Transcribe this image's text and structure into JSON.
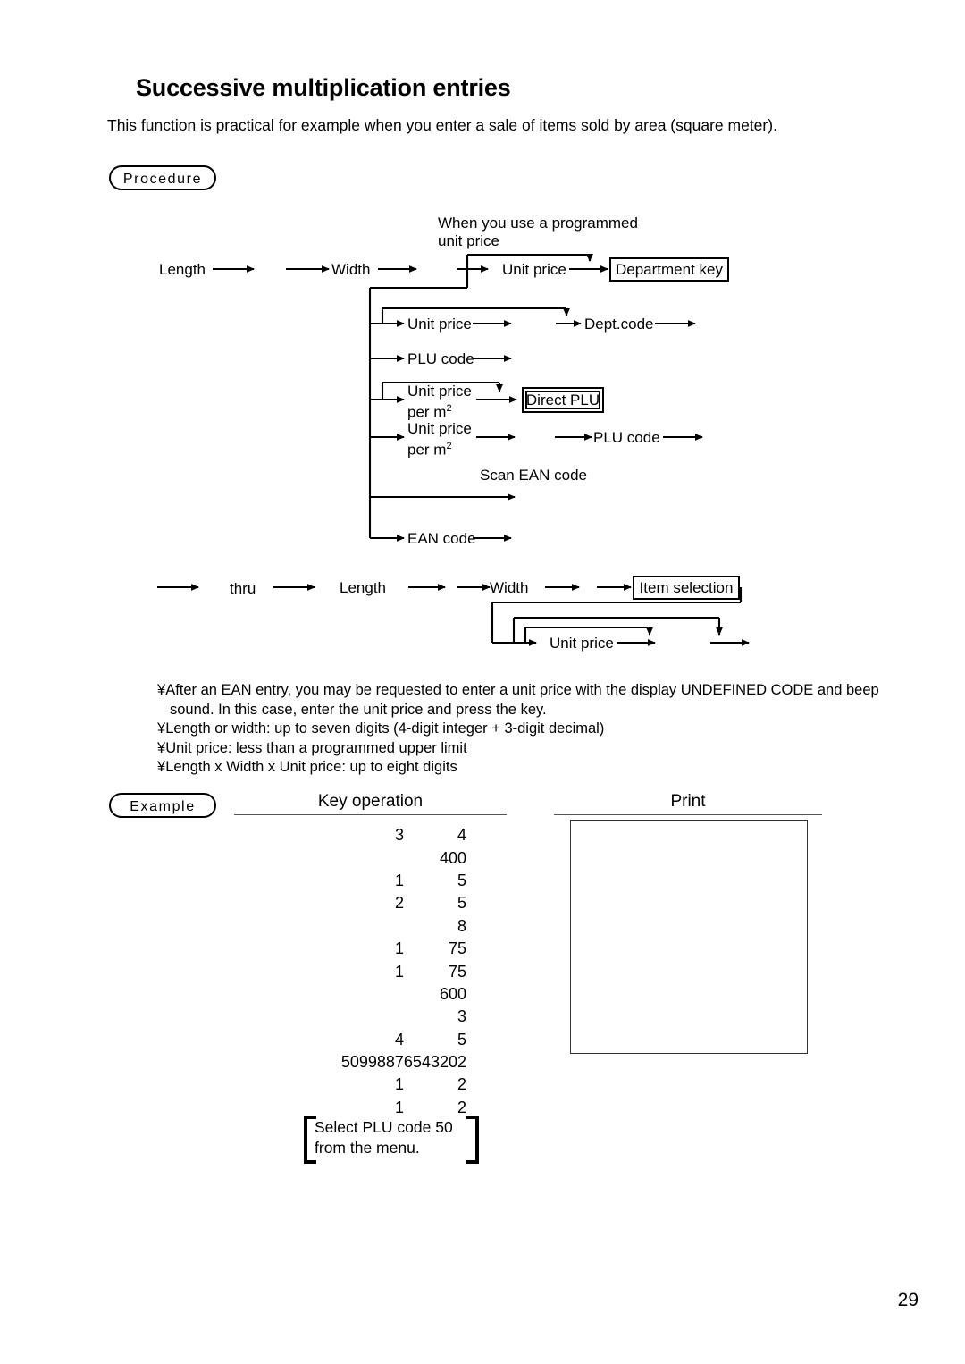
{
  "page": {
    "title": "Successive multiplication entries",
    "intro": "This function is practical for example when you enter a sale of items sold by area (square meter).",
    "number": "29"
  },
  "sections": {
    "procedure_label": "Procedure",
    "example_label": "Example"
  },
  "flow": {
    "annotation_line1": "When you use a programmed",
    "annotation_line2": "unit price",
    "length": "Length",
    "width": "Width",
    "unit_price_1": "Unit price",
    "department_key": "Department key",
    "unit_price_2": "Unit price",
    "dept_code": "Dept.code",
    "plu_code_1": "PLU code",
    "unit_price_per_m2_a_l1": "Unit price",
    "unit_price_per_m2_a_l2": "per m",
    "unit_price_per_m2_a_sup": "2",
    "direct_plu": "Direct PLU",
    "unit_price_per_m2_b_l1": "Unit price",
    "unit_price_per_m2_b_l2": "per m",
    "unit_price_per_m2_b_sup": "2",
    "plu_code_2": "PLU code",
    "scan_ean_code": "Scan EAN code",
    "ean_code": "EAN code",
    "thru": "thru",
    "length_2": "Length",
    "width_2": "Width",
    "item_selection": "Item selection",
    "unit_price_3": "Unit price"
  },
  "notes": [
    {
      "bullet": "¥",
      "text": "After an EAN entry, you may be requested to enter a unit price with the display  UNDEFINED CODE  and beep"
    },
    {
      "bullet": "",
      "text": "sound.  In this case, enter the unit price and press the         key."
    },
    {
      "bullet": "¥",
      "text": "Length or width: up to seven digits (4-digit integer + 3-digit decimal)"
    },
    {
      "bullet": "¥",
      "text": "Unit price: less than a programmed upper limit"
    },
    {
      "bullet": "¥",
      "text": "Length x Width x Unit price: up to eight digits"
    }
  ],
  "example": {
    "key_operation_header": "Key operation",
    "print_header": "Print",
    "rows": [
      {
        "col1": "3",
        "col2": "4",
        "wide": false
      },
      {
        "col1": "",
        "col2": "400",
        "wide": false
      },
      {
        "col1": "1",
        "col2": "5",
        "wide": false
      },
      {
        "col1": "2",
        "col2": "5",
        "wide": false
      },
      {
        "col1": "",
        "col2": "8",
        "wide": false
      },
      {
        "col1": "1",
        "col2": "75",
        "wide": false
      },
      {
        "col1": "1",
        "col2": "75",
        "wide": false
      },
      {
        "col1": "",
        "col2": "600",
        "wide": false
      },
      {
        "col1": "",
        "col2": "3",
        "wide": false
      },
      {
        "col1": "4",
        "col2": "5",
        "wide": false
      },
      {
        "col1": "50998876543202",
        "col2": "",
        "wide": true
      },
      {
        "col1": "1",
        "col2": "2",
        "wide": false
      },
      {
        "col1": "1",
        "col2": "2",
        "wide": false
      }
    ],
    "plu_note_line1": "Select PLU code 50",
    "plu_note_line2": "from the menu.",
    "print_content": ""
  }
}
